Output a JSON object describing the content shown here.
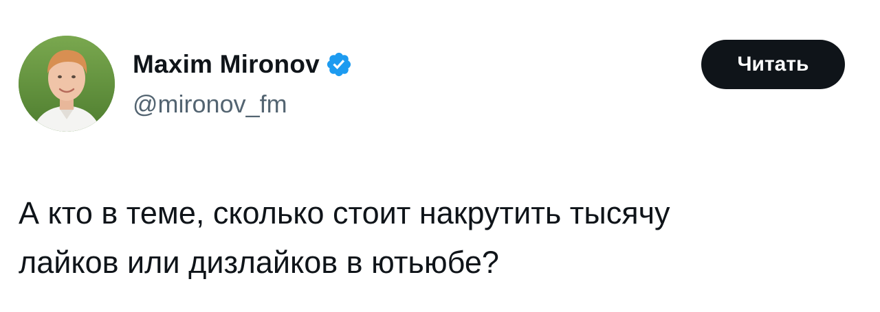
{
  "author": {
    "display_name": "Maxim Mironov",
    "handle": "@mironov_fm",
    "verified_icon": "verified-badge-icon",
    "avatar_icon": "avatar-photo"
  },
  "follow_button": {
    "label": "Читать"
  },
  "tweet": {
    "lines": [
      "А кто в теме, сколько стоит накрутить тысячу",
      "лайков или дизлайков в ютьюбе?"
    ]
  },
  "colors": {
    "text": "#0f1419",
    "secondary_text": "#536471",
    "button_bg": "#0f1419",
    "verified_blue": "#1d9bf0"
  }
}
